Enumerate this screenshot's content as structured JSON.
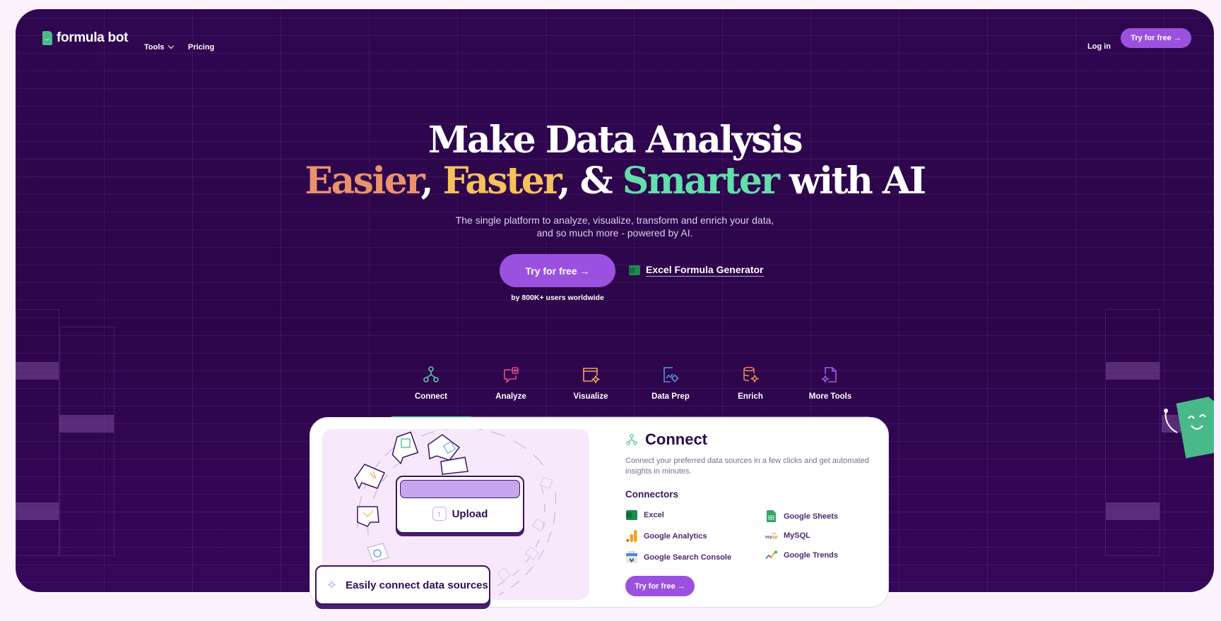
{
  "brand": {
    "name": "formula bot",
    "logo_icon": "smiling-sheet-icon"
  },
  "nav": {
    "tools_label": "Tools",
    "pricing_label": "Pricing",
    "login_label": "Log in",
    "cta_label": "Try for free →"
  },
  "hero": {
    "headline_line1": "Make Data Analysis",
    "word_easier": "Easier",
    "word_faster": "Faster",
    "amp": "&",
    "word_smarter": "Smarter",
    "with_ai": "with AI",
    "subtitle_line1": "The single platform to analyze, visualize, transform and enrich your data,",
    "subtitle_line2": "and so much more - powered by AI.",
    "cta_label": "Try for free →",
    "users_note": "by 800K+ users worldwide",
    "secondary_link": "Excel Formula Generator",
    "colors": {
      "easier": "#e9926b",
      "faster": "#f5c15a",
      "smarter": "#62deaa",
      "accent": "#9b51e0",
      "background": "#2f0650"
    }
  },
  "tabs": [
    {
      "label": "Connect",
      "icon": "connect-nodes-icon",
      "active": true
    },
    {
      "label": "Analyze",
      "icon": "chat-bot-icon",
      "active": false
    },
    {
      "label": "Visualize",
      "icon": "window-sparkle-icon",
      "active": false
    },
    {
      "label": "Data Prep",
      "icon": "doc-chart-gear-icon",
      "active": false
    },
    {
      "label": "Enrich",
      "icon": "database-sparkle-icon",
      "active": false
    },
    {
      "label": "More Tools",
      "icon": "file-sparkle-icon",
      "active": false
    }
  ],
  "panel": {
    "title": "Connect",
    "description": "Connect your preferred data sources in a few clicks and get automated insights in minutes.",
    "connectors_heading": "Connectors",
    "connectors": [
      {
        "name": "Excel",
        "icon": "excel-icon"
      },
      {
        "name": "Google Sheets",
        "icon": "google-sheets-icon"
      },
      {
        "name": "Google Analytics",
        "icon": "google-analytics-icon"
      },
      {
        "name": "MySQL",
        "icon": "mysql-icon"
      },
      {
        "name": "Google Search Console",
        "icon": "google-search-console-icon"
      },
      {
        "name": "Google Trends",
        "icon": "google-trends-icon"
      }
    ],
    "cta_label": "Try for free →",
    "illustration": {
      "upload_label": "Upload",
      "badge_text": "Easily connect data sources"
    }
  }
}
